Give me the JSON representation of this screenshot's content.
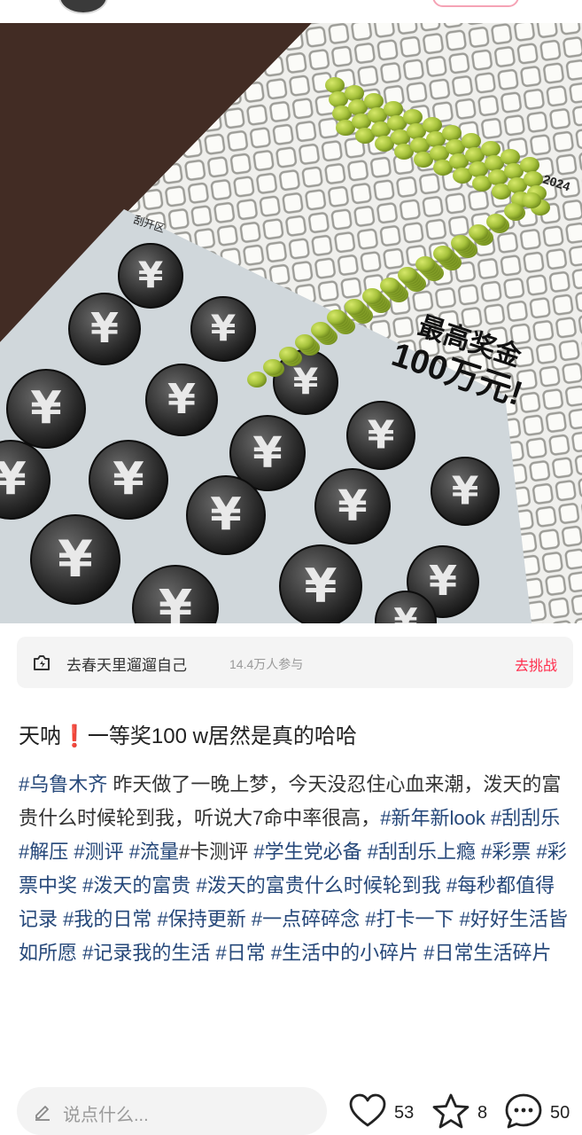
{
  "challenge": {
    "name": "去春天里遛遛自己",
    "participants": "14.4万人参与",
    "cta": "去挑战"
  },
  "photo": {
    "ticket_tagline_1": "最高奖金",
    "ticket_tagline_2": "100万元!",
    "ticket_corner": "刮开区",
    "ticket_year": "2024",
    "symbol": "¥"
  },
  "post": {
    "title_before": "天呐",
    "title_emoji": "❗",
    "title_after": "一等奖100 w居然是真的哈哈",
    "body": [
      {
        "t": "tag",
        "v": "#乌鲁木齐"
      },
      {
        "t": "text",
        "v": " 昨天做了一晚上梦，今天没忍住心血来潮，泼天的富贵什么时候轮到我，听说大7命中率很高，"
      },
      {
        "t": "tag",
        "v": "#新年新look"
      },
      {
        "t": "text",
        "v": " "
      },
      {
        "t": "tag",
        "v": "#刮刮乐"
      },
      {
        "t": "text",
        "v": " "
      },
      {
        "t": "tag",
        "v": "#解压"
      },
      {
        "t": "text",
        "v": " "
      },
      {
        "t": "tag",
        "v": "#测评"
      },
      {
        "t": "text",
        "v": " "
      },
      {
        "t": "tag",
        "v": "#流量"
      },
      {
        "t": "text",
        "v": "#卡测评 "
      },
      {
        "t": "tag",
        "v": "#学生党必备"
      },
      {
        "t": "text",
        "v": " "
      },
      {
        "t": "tag",
        "v": "#刮刮乐上瘾"
      },
      {
        "t": "text",
        "v": " "
      },
      {
        "t": "tag",
        "v": "#彩票"
      },
      {
        "t": "text",
        "v": " "
      },
      {
        "t": "tag",
        "v": "#彩票中奖"
      },
      {
        "t": "text",
        "v": " "
      },
      {
        "t": "tag",
        "v": "#泼天的富贵"
      },
      {
        "t": "text",
        "v": " "
      },
      {
        "t": "tag",
        "v": "#泼天的富贵什么时候轮到我"
      },
      {
        "t": "text",
        "v": " "
      },
      {
        "t": "tag",
        "v": "#每秒都值得记录"
      },
      {
        "t": "text",
        "v": " "
      },
      {
        "t": "tag",
        "v": "#我的日常"
      },
      {
        "t": "text",
        "v": " "
      },
      {
        "t": "tag",
        "v": "#保持更新"
      },
      {
        "t": "text",
        "v": " "
      },
      {
        "t": "tag",
        "v": "#一点碎碎念"
      },
      {
        "t": "text",
        "v": " "
      },
      {
        "t": "tag",
        "v": "#打卡一下"
      },
      {
        "t": "text",
        "v": " "
      },
      {
        "t": "tag",
        "v": "#好好生活皆如所愿"
      },
      {
        "t": "text",
        "v": " "
      },
      {
        "t": "tag",
        "v": "#记录我的生活"
      },
      {
        "t": "text",
        "v": " "
      },
      {
        "t": "tag",
        "v": "#日常"
      },
      {
        "t": "text",
        "v": " "
      },
      {
        "t": "tag",
        "v": "#生活中的小碎片"
      },
      {
        "t": "text",
        "v": " "
      },
      {
        "t": "tag",
        "v": "#日常生活碎片"
      }
    ]
  },
  "bottom_bar": {
    "comment_placeholder": "说点什么...",
    "likes": "53",
    "favorites": "8",
    "comments": "50"
  },
  "colors": {
    "accent": "#ff2e4d",
    "tag": "#26487a",
    "ticket_green": "#a6c23c"
  },
  "icons": [
    "live-camera-icon",
    "pencil-icon",
    "heart-icon",
    "star-icon",
    "comment-bubble-icon",
    "yuan-coin-icon"
  ]
}
